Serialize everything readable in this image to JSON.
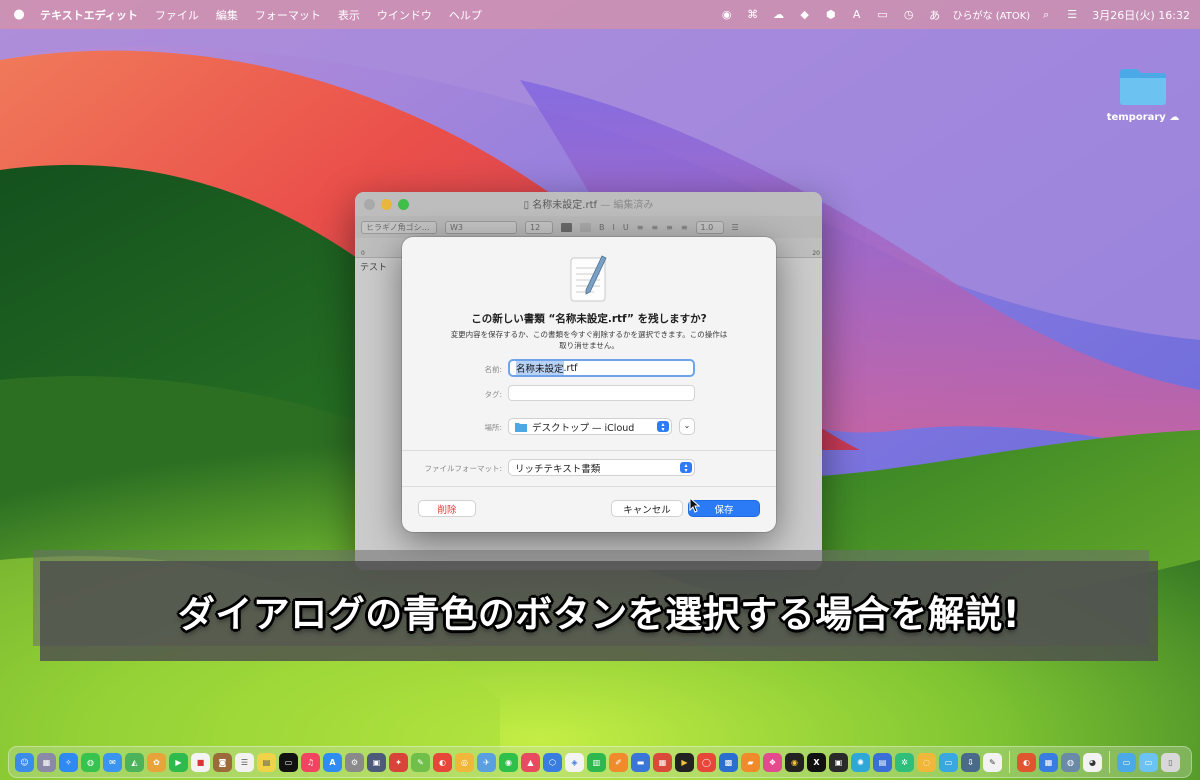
{
  "menubar": {
    "app_name": "テキストエディット",
    "items": [
      "ファイル",
      "編集",
      "フォーマット",
      "表示",
      "ウインドウ",
      "ヘルプ"
    ],
    "input_method": "ひらがな (ATOK)",
    "datetime": "3月26日(火)  16:32",
    "status_icons": [
      "record-icon",
      "command-icon",
      "cloud-icon",
      "dropbox-icon",
      "hexagon-icon",
      "font-icon",
      "battery-icon",
      "clock-history-icon",
      "input-method-icon",
      "search-icon",
      "control-center-icon"
    ]
  },
  "desktop": {
    "folder_label": "temporary"
  },
  "textedit": {
    "title": "名称未設定.rtf",
    "title_suffix": "— 編集済み",
    "font_family": "ヒラギノ角ゴシ…",
    "font_weight": "W3",
    "font_size": "12",
    "style_bold": "B",
    "style_italic": "I",
    "style_underline": "U",
    "line_spacing": "1.0",
    "ruler_start": "0",
    "ruler_end": "20",
    "body_text": "テスト"
  },
  "dialog": {
    "title": "この新しい書類 “名称未設定.rtf” を残しますか?",
    "message": "変更内容を保存するか、この書類を今すぐ削除するかを選択できます。この操作は取り消せません。",
    "name_label": "名前:",
    "name_selected": "名称未設定",
    "name_ext": ".rtf",
    "tags_label": "タグ:",
    "where_label": "場所:",
    "where_value": "デスクトップ — iCloud",
    "format_label": "ファイルフォーマット:",
    "format_value": "リッチテキスト書類",
    "delete_label": "削除",
    "cancel_label": "キャンセル",
    "save_label": "保存"
  },
  "banner": {
    "text": "ダイアログの青色のボタンを選択する場合を解説!"
  },
  "colors": {
    "accent_blue": "#2c7bf6",
    "delete_red": "#e03a2e"
  }
}
